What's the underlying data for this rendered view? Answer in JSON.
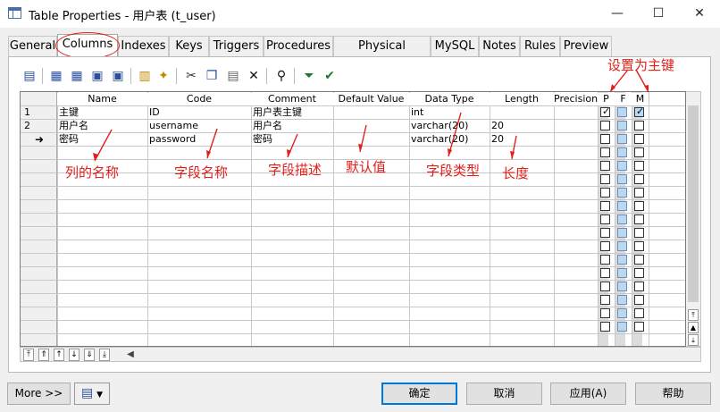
{
  "window": {
    "title": "Table Properties - 用户表 (t_user)",
    "controls": [
      "—",
      "☐",
      "✕"
    ]
  },
  "tabs": [
    "General",
    "Columns",
    "Indexes",
    "Keys",
    "Triggers",
    "Procedures",
    "Physical Options",
    "MySQL",
    "Notes",
    "Rules",
    "Preview"
  ],
  "active_tab": "Columns",
  "toolbar_icons": [
    "properties-icon",
    "insert-row-icon",
    "add-row-icon",
    "copy-row-icon",
    "paste-row-icon",
    "add-columns-icon",
    "reuse-columns-icon",
    "cut-icon",
    "copy-icon",
    "paste-icon",
    "delete-icon",
    "find-icon",
    "filter-icon",
    "customize-columns-icon"
  ],
  "grid": {
    "headers": [
      "Name",
      "Code",
      "Comment",
      "Default Value",
      "Data Type",
      "Length",
      "Precision",
      "P",
      "F",
      "M"
    ],
    "rows": [
      {
        "num": "1",
        "name": "主键",
        "code": "ID",
        "comment": "用户表主键",
        "default": "",
        "type": "int",
        "length": "",
        "precision": "",
        "p": true,
        "f": false,
        "m": true
      },
      {
        "num": "2",
        "name": "用户名",
        "code": "username",
        "comment": "用户名",
        "default": "",
        "type": "varchar(20)",
        "length": "20",
        "precision": "",
        "p": false,
        "f": false,
        "m": false
      },
      {
        "num": "➜",
        "name": "密码",
        "code": "password",
        "comment": "密码",
        "default": "",
        "type": "varchar(20)",
        "length": "20",
        "precision": "",
        "p": false,
        "f": false,
        "m": false
      }
    ],
    "empty_rows": 14
  },
  "annotations": {
    "primary_key": "设置为主键",
    "name": "列的名称",
    "code": "字段名称",
    "comment": "字段描述",
    "default": "默认值",
    "type": "字段类型",
    "length": "长度"
  },
  "nav_buttons": [
    "⤒",
    "⇑",
    "↑",
    "↓",
    "⇓",
    "⤓"
  ],
  "footer": {
    "more": "More >>",
    "ok": "确定",
    "cancel": "取消",
    "apply": "应用(A)",
    "help": "帮助"
  }
}
